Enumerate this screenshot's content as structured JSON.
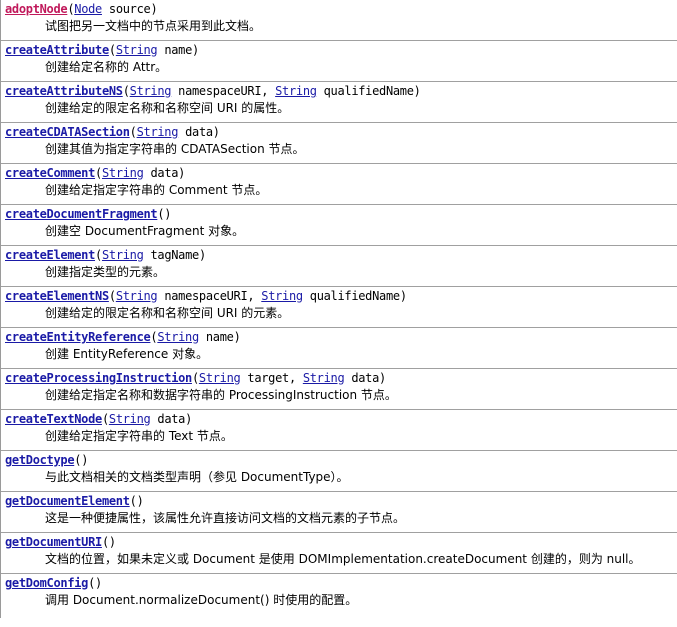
{
  "methods": [
    {
      "name": "adoptNode",
      "visited": true,
      "params": [
        {
          "type": "Node",
          "name": "source"
        }
      ],
      "description": "试图把另一文档中的节点采用到此文档。"
    },
    {
      "name": "createAttribute",
      "params": [
        {
          "type": "String",
          "name": "name"
        }
      ],
      "description": "创建给定名称的 Attr。"
    },
    {
      "name": "createAttributeNS",
      "params": [
        {
          "type": "String",
          "name": "namespaceURI"
        },
        {
          "type": "String",
          "name": "qualifiedName"
        }
      ],
      "description": "创建给定的限定名称和名称空间 URI 的属性。"
    },
    {
      "name": "createCDATASection",
      "params": [
        {
          "type": "String",
          "name": "data"
        }
      ],
      "description": "创建其值为指定字符串的 CDATASection 节点。"
    },
    {
      "name": "createComment",
      "params": [
        {
          "type": "String",
          "name": "data"
        }
      ],
      "description": "创建给定指定字符串的 Comment 节点。"
    },
    {
      "name": "createDocumentFragment",
      "params": [],
      "description": "创建空 DocumentFragment 对象。"
    },
    {
      "name": "createElement",
      "params": [
        {
          "type": "String",
          "name": "tagName"
        }
      ],
      "description": "创建指定类型的元素。"
    },
    {
      "name": "createElementNS",
      "params": [
        {
          "type": "String",
          "name": "namespaceURI"
        },
        {
          "type": "String",
          "name": "qualifiedName"
        }
      ],
      "description": "创建给定的限定名称和名称空间 URI 的元素。"
    },
    {
      "name": "createEntityReference",
      "params": [
        {
          "type": "String",
          "name": "name"
        }
      ],
      "description": "创建 EntityReference 对象。"
    },
    {
      "name": "createProcessingInstruction",
      "params": [
        {
          "type": "String",
          "name": "target"
        },
        {
          "type": "String",
          "name": "data"
        }
      ],
      "description": "创建给定指定名称和数据字符串的 ProcessingInstruction 节点。"
    },
    {
      "name": "createTextNode",
      "params": [
        {
          "type": "String",
          "name": "data"
        }
      ],
      "description": "创建给定指定字符串的 Text 节点。"
    },
    {
      "name": "getDoctype",
      "params": [],
      "description": "与此文档相关的文档类型声明（参见 DocumentType）。"
    },
    {
      "name": "getDocumentElement",
      "params": [],
      "description": "这是一种便捷属性，该属性允许直接访问文档的文档元素的子节点。"
    },
    {
      "name": "getDocumentURI",
      "params": [],
      "description": "文档的位置，如果未定义或 Document 是使用 DOMImplementation.createDocument 创建的，则为 null。"
    },
    {
      "name": "getDomConfig",
      "params": [],
      "description": "调用 Document.normalizeDocument() 时使用的配置。"
    }
  ]
}
